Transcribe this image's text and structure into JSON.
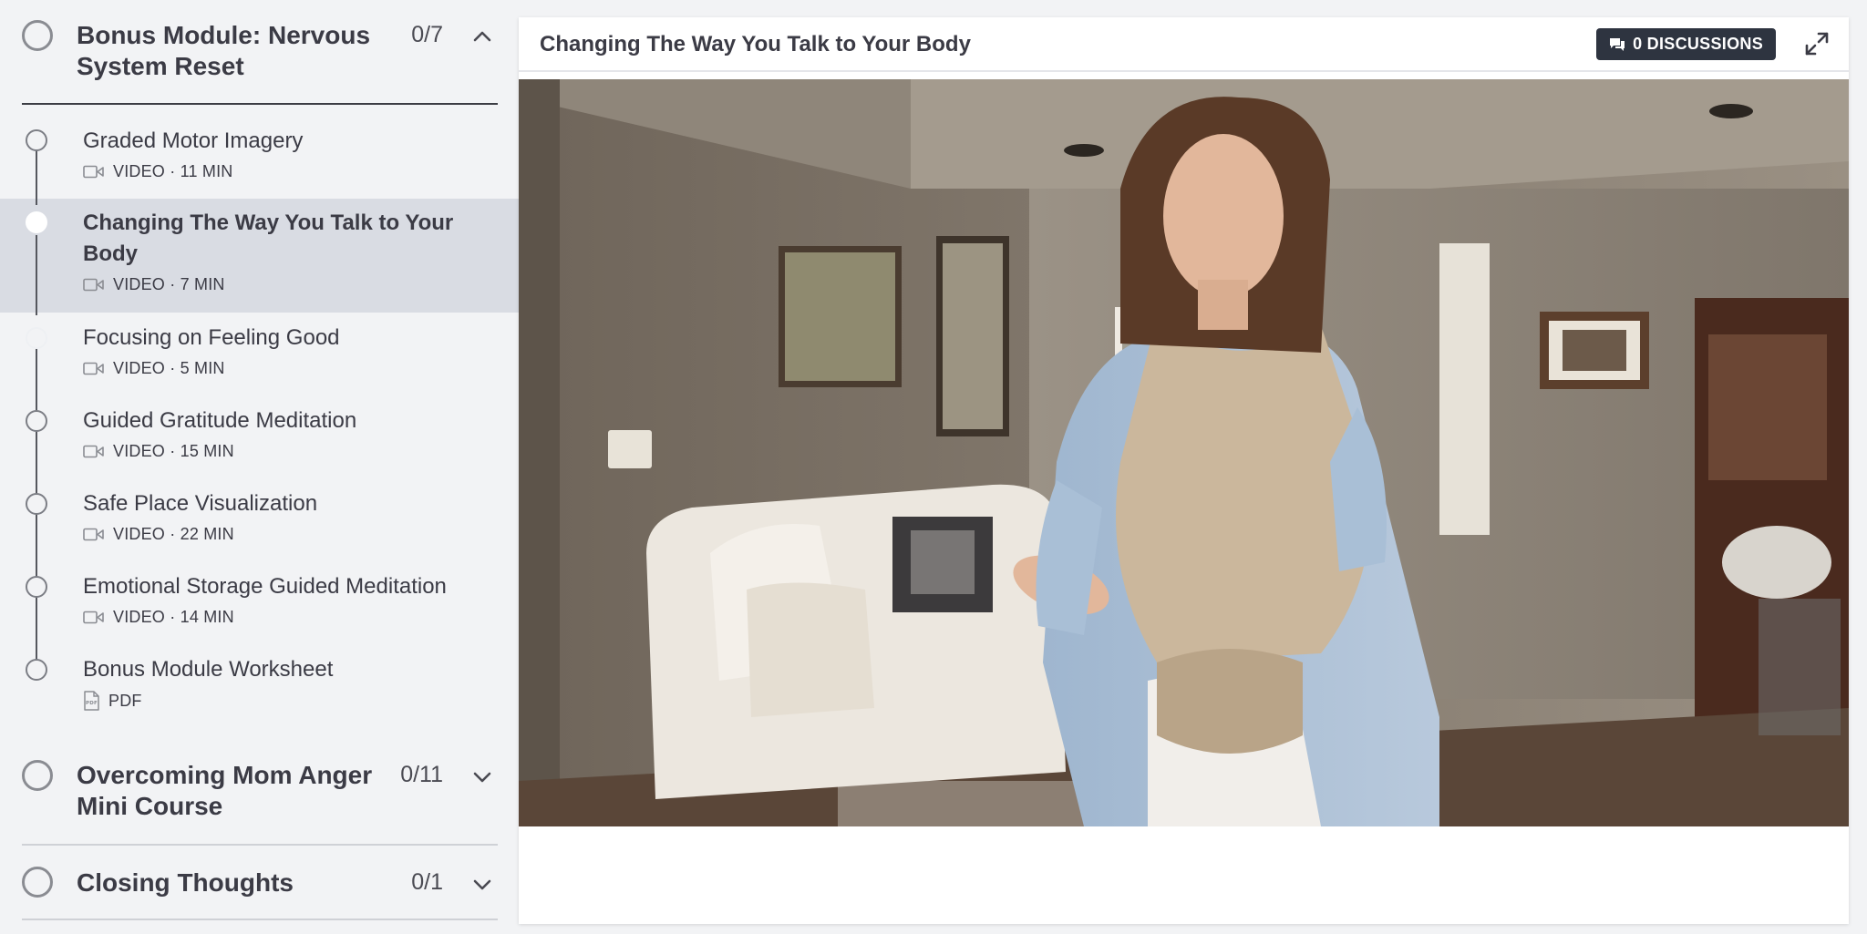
{
  "sidebar": {
    "modules": [
      {
        "title": "Bonus Module: Nervous System Reset",
        "title_line1": "Bonus Module: Nervous",
        "title_line2": "System Reset",
        "progress": "0/7",
        "expanded": true
      },
      {
        "title": "Overcoming Mom Anger Mini Course",
        "title_line1": "Overcoming Mom Anger",
        "title_line2": "Mini Course",
        "progress": "0/11",
        "expanded": false
      },
      {
        "title": "Closing Thoughts",
        "progress": "0/1",
        "expanded": false
      }
    ],
    "lessons": [
      {
        "title": "Graded Motor Imagery",
        "meta": "VIDEO · 11 MIN",
        "icon": "video-camera-icon"
      },
      {
        "title": "Changing The Way You Talk to Your Body",
        "title_line1": "Changing The Way You Talk to Your",
        "title_line2": "Body",
        "meta": "VIDEO · 7 MIN",
        "icon": "video-camera-icon",
        "active": true
      },
      {
        "title": "Focusing on Feeling Good",
        "meta": "VIDEO · 5 MIN",
        "icon": "video-camera-icon"
      },
      {
        "title": "Guided Gratitude Meditation",
        "meta": "VIDEO · 15 MIN",
        "icon": "video-camera-icon"
      },
      {
        "title": "Safe Place Visualization",
        "meta": "VIDEO · 22 MIN",
        "icon": "video-camera-icon"
      },
      {
        "title": "Emotional Storage Guided Meditation",
        "meta": "VIDEO · 14 MIN",
        "icon": "video-camera-icon"
      },
      {
        "title": "Bonus Module Worksheet",
        "meta": "PDF",
        "icon": "pdf-file-icon"
      }
    ]
  },
  "player": {
    "title": "Changing The Way You Talk to Your Body",
    "discussions_label": "0 DISCUSSIONS",
    "discussions_icon": "chat-bubbles-icon",
    "expand_icon": "expand-icon"
  },
  "colors": {
    "active_row": "#d9dce3",
    "discussion_button": "#2e3440",
    "page_background": "#f2f3f5"
  }
}
